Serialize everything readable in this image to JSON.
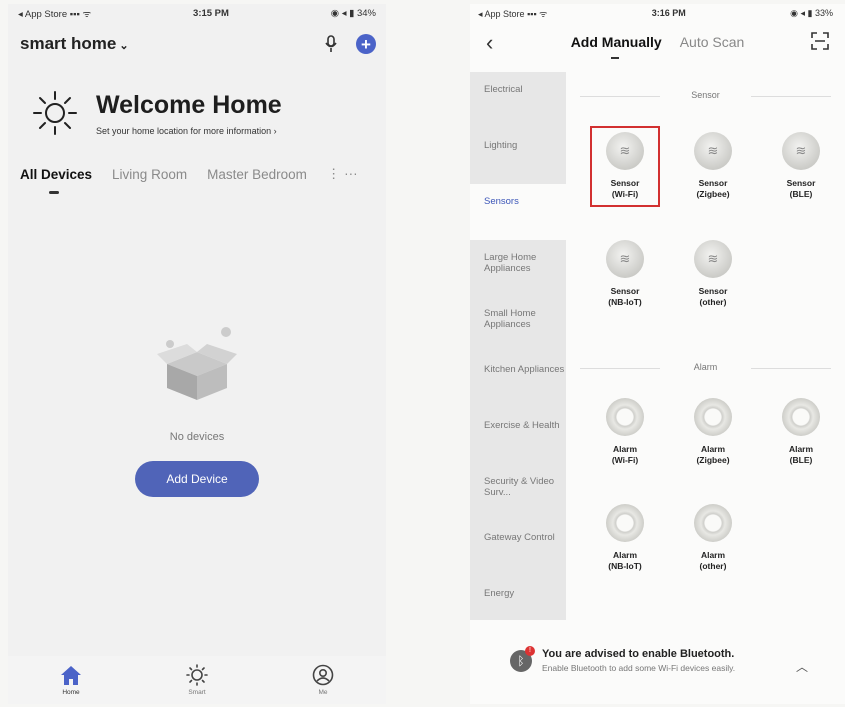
{
  "left": {
    "status": {
      "carrier": "◂ App Store",
      "signal": "▪▪▪ ᯤ",
      "time": "3:15 PM",
      "right": "◉ ◂ ▮ 34%"
    },
    "home_selector": "smart home",
    "welcome": {
      "title": "Welcome Home",
      "subtitle": "Set your home location for more information"
    },
    "tabs": [
      {
        "label": "All Devices"
      },
      {
        "label": "Living Room"
      },
      {
        "label": "Master Bedroom"
      },
      {
        "label": "⋮ ···"
      }
    ],
    "empty_text": "No devices",
    "add_device_label": "Add Device",
    "tabbar": [
      {
        "label": "Home"
      },
      {
        "label": "Smart"
      },
      {
        "label": "Me"
      }
    ]
  },
  "right": {
    "status": {
      "carrier": "◂ App Store",
      "signal": "▪▪▪ ᯤ",
      "time": "3:16 PM",
      "right": "◉ ◂ ▮ 33%"
    },
    "nav": {
      "back": "‹",
      "add_manually": "Add Manually",
      "auto_scan": "Auto Scan"
    },
    "categories": [
      {
        "label": "Electrical"
      },
      {
        "label": "Lighting"
      },
      {
        "label": "Sensors"
      },
      {
        "label": "Large Home Appliances"
      },
      {
        "label": "Small Home Appliances"
      },
      {
        "label": "Kitchen Appliances"
      },
      {
        "label": "Exercise & Health"
      },
      {
        "label": "Security & Video Surv..."
      },
      {
        "label": "Gateway Control"
      },
      {
        "label": "Energy"
      }
    ],
    "sections": {
      "sensor": "Sensor",
      "alarm": "Alarm"
    },
    "sensor_devices": [
      {
        "name": "Sensor",
        "proto": "(Wi-Fi)"
      },
      {
        "name": "Sensor",
        "proto": "(Zigbee)"
      },
      {
        "name": "Sensor",
        "proto": "(BLE)"
      },
      {
        "name": "Sensor",
        "proto": "(NB-IoT)"
      },
      {
        "name": "Sensor",
        "proto": "(other)"
      }
    ],
    "alarm_devices": [
      {
        "name": "Alarm",
        "proto": "(Wi-Fi)"
      },
      {
        "name": "Alarm",
        "proto": "(Zigbee)"
      },
      {
        "name": "Alarm",
        "proto": "(BLE)"
      },
      {
        "name": "Alarm",
        "proto": "(NB-IoT)"
      },
      {
        "name": "Alarm",
        "proto": "(other)"
      }
    ],
    "notice": {
      "title": "You are advised to enable Bluetooth.",
      "subtitle": "Enable Bluetooth to add some Wi-Fi devices easily.",
      "badge": "!"
    }
  },
  "colors": {
    "accent": "#4b63c8",
    "button": "#5064b8",
    "highlight": "#d23030",
    "active_category": "#3c56b8"
  }
}
